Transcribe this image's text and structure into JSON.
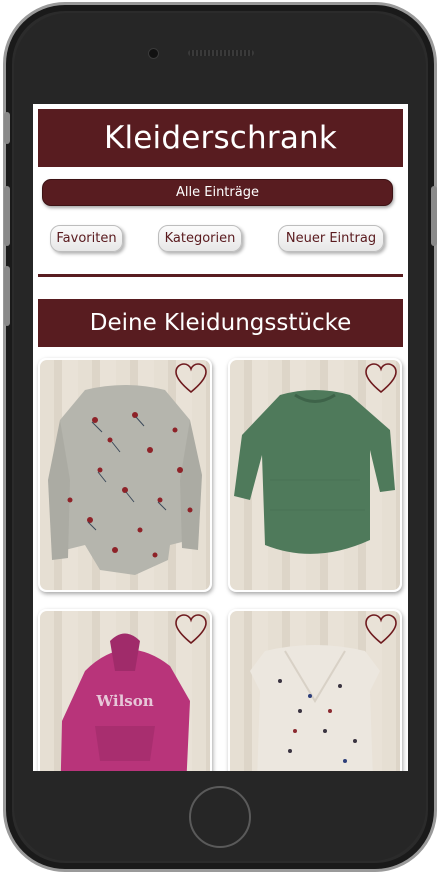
{
  "app": {
    "title": "Kleiderschrank"
  },
  "nav": {
    "all_entries": "Alle Einträge",
    "favorites": "Favoriten",
    "categories": "Kategorien",
    "new_entry": "Neuer Eintrag"
  },
  "section": {
    "title": "Deine Kleidungsstücke"
  },
  "colors": {
    "accent": "#581c20",
    "heart": "#6e1a1e"
  },
  "items": [
    {
      "garment": "grey floral blouse",
      "icon": "heart-outline-icon"
    },
    {
      "garment": "green knit sweater",
      "icon": "heart-outline-icon"
    },
    {
      "garment": "pink hoodie",
      "icon": "heart-outline-icon",
      "print": "Wilson"
    },
    {
      "garment": "white floral dress",
      "icon": "heart-outline-icon"
    }
  ]
}
